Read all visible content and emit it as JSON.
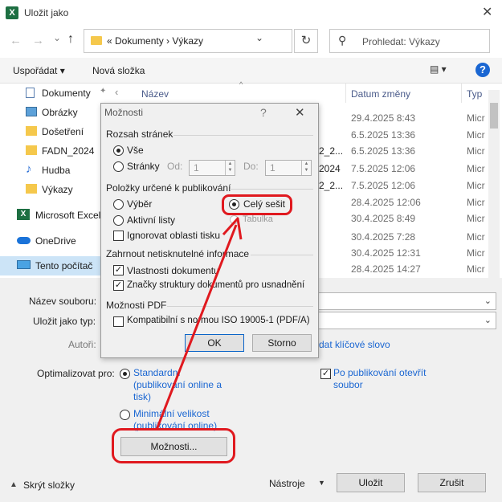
{
  "window": {
    "title": "Uložit jako",
    "app_icon": "X",
    "close_glyph": "✕"
  },
  "nav": {
    "back_glyph": "←",
    "forward_glyph": "→",
    "dropdown_glyph": "⌄",
    "up_glyph": "↑",
    "address": "«  Dokumenty  ›  Výkazy",
    "address_chevron": "⌄",
    "refresh_glyph": "↻",
    "search_placeholder": "Prohledat: Výkazy"
  },
  "toolbar": {
    "organize": "Uspořádat ▾",
    "new_folder": "Nová složka",
    "view_glyph": "▤ ▾",
    "help": "?"
  },
  "sidebar": {
    "items": [
      {
        "label": "Dokumenty",
        "icon": "document-icon",
        "pin": "📌",
        "expander": "‹"
      },
      {
        "label": "Obrázky",
        "icon": "pictures-icon"
      },
      {
        "label": "Došetření",
        "icon": "folder-icon"
      },
      {
        "label": "FADN_2024",
        "icon": "folder-icon"
      },
      {
        "label": "Hudba",
        "icon": "music-icon"
      },
      {
        "label": "Výkazy",
        "icon": "folder-icon"
      },
      {
        "label": "Microsoft Excel",
        "icon": "excel-icon"
      },
      {
        "label": "OneDrive",
        "icon": "cloud-icon"
      },
      {
        "label": "Tento počítač",
        "icon": "pc-icon"
      }
    ]
  },
  "filelist": {
    "headers": {
      "name": "Název",
      "date": "Datum změny",
      "type": "Typ",
      "sort_glyph": "^"
    },
    "rows": [
      {
        "partial": "",
        "date": "29.4.2025 8:43",
        "type": "Micr"
      },
      {
        "partial": "",
        "date": "6.5.2025 13:36",
        "type": "Micr"
      },
      {
        "partial": "2_2...",
        "date": "6.5.2025 13:36",
        "type": "Micr"
      },
      {
        "partial": "",
        "date": "7.5.2025 12:06",
        "type": "Micr"
      },
      {
        "partial": "2024",
        "date": "7.5.2025 12:06",
        "type": "Micr"
      },
      {
        "partial": "2_2...",
        "date": "7.5.2025 12:06",
        "type": "Micr"
      },
      {
        "partial": "",
        "date": "28.4.2025 12:06",
        "type": "Micr"
      },
      {
        "partial": "",
        "date": "30.4.2025 8:49",
        "type": "Micr"
      },
      {
        "partial": "",
        "date": "30.4.2025 7:28",
        "type": "Micr"
      },
      {
        "partial": "",
        "date": "30.4.2025 12:31",
        "type": "Micr"
      },
      {
        "partial": "",
        "date": "28.4.2025 14:27",
        "type": "Micr"
      }
    ]
  },
  "form": {
    "filename_label": "Název souboru:",
    "filetype_label": "Uložit jako typ:",
    "authors_label": "Autoři:",
    "tags_link": "dat klíčové slovo",
    "optimize_label": "Optimalizovat pro:",
    "opt_standard": "Standardní (publikování online a tisk)",
    "opt_standard_l1": "Standardní",
    "opt_standard_l2": "(publikování online a",
    "opt_standard_l3": "tisk)",
    "opt_minimal_l1": "Minimální velikost",
    "opt_minimal_l2": "(publikování online)",
    "open_after_l1": "Po publikování otevřít",
    "open_after_l2": "soubor",
    "options_button": "Možnosti...",
    "hide_folders": "Skrýt složky",
    "tools": "Nástroje",
    "save": "Uložit",
    "cancel": "Zrušit"
  },
  "dialog": {
    "title": "Možnosti",
    "help": "?",
    "close": "✕",
    "range_group": "Rozsah stránek",
    "range_all": "Vše",
    "range_pages": "Stránky",
    "from_label": "Od:",
    "from_value": "1",
    "to_label": "Do:",
    "to_value": "1",
    "publish_group": "Položky určené k publikování",
    "pub_selection": "Výběr",
    "pub_whole": "Celý sešit",
    "pub_active": "Aktivní listy",
    "pub_table": "Tabulka",
    "ignore_print": "Ignorovat oblasti tisku",
    "nonprint_group": "Zahrnout netisknutelné informace",
    "doc_props": "Vlastnosti dokumentu",
    "struct_tags": "Značky struktury dokumentů pro usnadnění",
    "pdf_group": "Možnosti PDF",
    "pdfa": "Kompatibilní s normou ISO 19005-1 (PDF/A)",
    "ok": "OK",
    "storno": "Storno"
  },
  "colors": {
    "annotation": "#e0191f",
    "accent": "#1a66d2"
  }
}
